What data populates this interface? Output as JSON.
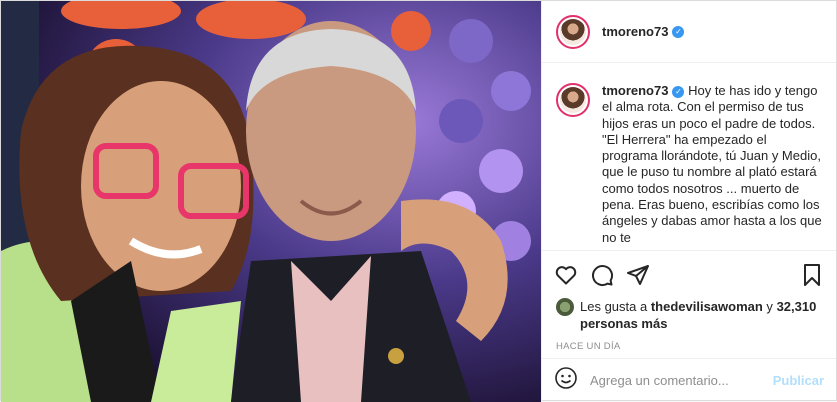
{
  "post": {
    "username": "tmoreno73",
    "verified_mark": "✓",
    "caption": "Hoy te has ido y tengo el alma rota. Con el permiso de tus hijos eras un poco el padre de todos. \"El Herrera\" ha empezado el programa llorándote, tú Juan y Medio, que le puso tu nombre al plató estará como todos nosotros ... muerto de pena. Eras bueno, escribías como los ángeles y dabas amor hasta a los que no te",
    "likes_prefix": "Les gusta a ",
    "likes_user": "thedevilisawoman",
    "likes_suffix": " y",
    "likes_count": "32,310 personas más",
    "time": "HACE UN DÍA",
    "comment_placeholder": "Agrega un comentario...",
    "publish_label": "Publicar"
  },
  "icons": {
    "like": "heart-icon",
    "comment": "comment-icon",
    "share": "share-icon",
    "save": "bookmark-icon",
    "emoji": "emoji-icon"
  },
  "colors": {
    "verified": "#3897f0",
    "publish_disabled": "#b2dffc",
    "story_ring": "#e1306c"
  }
}
